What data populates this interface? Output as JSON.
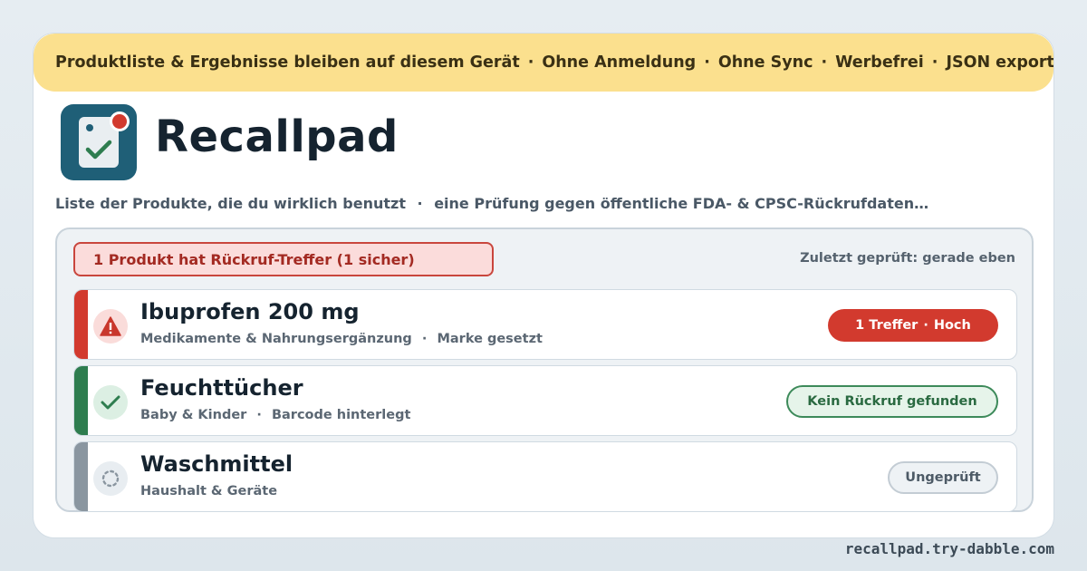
{
  "banner": {
    "items": [
      "Produktliste & Ergebnisse bleiben auf diesem Gerät",
      "Ohne Anmeldung",
      "Ohne Sync",
      "Werbefrei",
      "JSON exportieren"
    ],
    "separator": "·"
  },
  "app": {
    "title": "Recallpad",
    "logo_icon": "clipboard-check-icon"
  },
  "subtitle": {
    "part1": "Liste der Produkte, die du wirklich benutzt",
    "part2": "eine Prüfung gegen öffentliche FDA- & CPSC-Rückrufdaten…",
    "separator": "·"
  },
  "panel": {
    "alert_text": "1 Produkt hat Rückruf-Treffer (1 sicher)",
    "last_checked": "Zuletzt geprüft: gerade eben"
  },
  "products": [
    {
      "name": "Ibuprofen 200 mg",
      "category": "Medikamente & Nahrungsergänzung",
      "detail": "Marke gesetzt",
      "status_icon": "warning-icon",
      "status_label_1": "1 Treffer",
      "status_label_2": "Hoch",
      "accent": "#d23a2e"
    },
    {
      "name": "Feuchttücher",
      "category": "Baby & Kinder",
      "detail": "Barcode hinterlegt",
      "status_icon": "check-icon",
      "status_label_1": "Kein Rückruf gefunden",
      "accent": "#2e7d4f"
    },
    {
      "name": "Waschmittel",
      "category": "Haushalt & Geräte",
      "status_icon": "pending-icon",
      "status_label_1": "Ungeprüft",
      "accent": "#8a96a0"
    }
  ],
  "footer": {
    "url": "recallpad.try-dabble.com"
  },
  "colors": {
    "banner_bg": "#fbe08e",
    "danger": "#d23a2e",
    "success": "#2e7d4f",
    "neutral": "#8a96a0",
    "brand": "#1f5f77"
  }
}
